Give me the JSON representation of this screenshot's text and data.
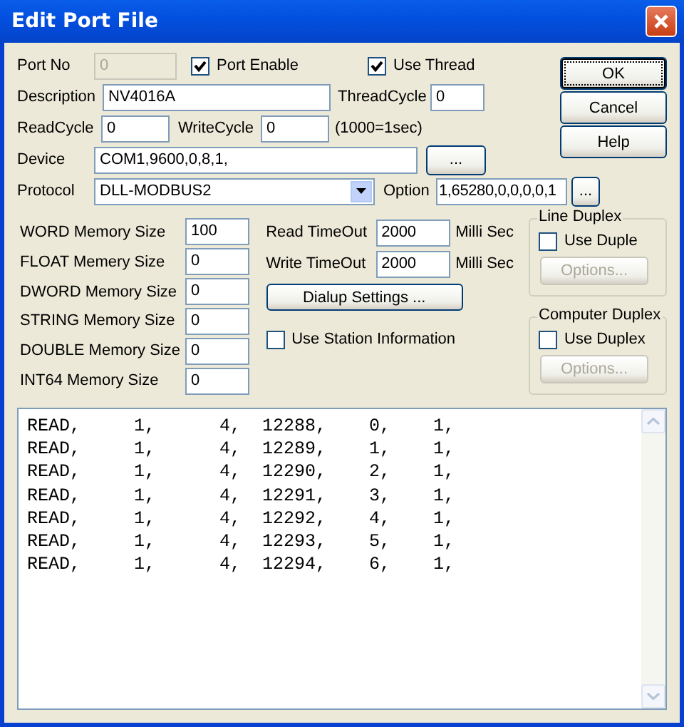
{
  "window": {
    "title": "Edit Port File"
  },
  "port_no": {
    "label": "Port No",
    "value": "0",
    "disabled": true
  },
  "port_enable": {
    "label": "Port Enable",
    "checked": true
  },
  "use_thread": {
    "label": "Use Thread",
    "checked": true
  },
  "description": {
    "label": "Description",
    "value": "NV4016A"
  },
  "thread_cycle": {
    "label": "ThreadCycle",
    "value": "0"
  },
  "read_cycle": {
    "label": "ReadCycle",
    "value": "0"
  },
  "write_cycle": {
    "label": "WriteCycle",
    "value": "0"
  },
  "cycle_note": "(1000=1sec)",
  "device": {
    "label": "Device",
    "value": "COM1,9600,0,8,1,",
    "button": "..."
  },
  "protocol": {
    "label": "Protocol",
    "value": "DLL-MODBUS2"
  },
  "option": {
    "label": "Option",
    "value": "1,65280,0,0,0,0,1",
    "button": "..."
  },
  "memory_sizes": [
    {
      "label": "WORD Memory Size",
      "value": "100"
    },
    {
      "label": "FLOAT Memery Size",
      "value": "0"
    },
    {
      "label": "DWORD Memory Size",
      "value": "0"
    },
    {
      "label": "STRING Memory Size",
      "value": "0"
    },
    {
      "label": "DOUBLE Memory Size",
      "value": "0"
    },
    {
      "label": "INT64 Memory Size",
      "value": "0"
    }
  ],
  "timeouts": [
    {
      "label": "Read TimeOut",
      "value": "2000",
      "unit": "Milli Sec"
    },
    {
      "label": "Write TimeOut",
      "value": "2000",
      "unit": "Milli Sec"
    }
  ],
  "dialup_button": "Dialup Settings ...",
  "use_station": {
    "label": "Use Station Information",
    "checked": false
  },
  "duplex_groups": [
    {
      "title": "Line Duplex",
      "checkbox_label": "Use Duple",
      "checked": false,
      "options_button": "Options...",
      "options_disabled": true
    },
    {
      "title": "Computer Duplex",
      "checkbox_label": "Use Duplex",
      "checked": false,
      "options_button": "Options...",
      "options_disabled": true
    }
  ],
  "buttons": [
    {
      "label": "OK",
      "default": true
    },
    {
      "label": "Cancel",
      "default": false
    },
    {
      "label": "Help",
      "default": false
    }
  ],
  "script_lines": [
    "READ,     1,      4,  12288,    0,    1,",
    "READ,     1,      4,  12289,    1,    1,",
    "READ,     1,      4,  12290,    2,    1,",
    "READ,     1,      4,  12291,    3,    1,",
    "READ,     1,      4,  12292,    4,    1,",
    "READ,     1,      4,  12293,    5,    1,",
    "READ,     1,      4,  12294,    6,    1,"
  ]
}
